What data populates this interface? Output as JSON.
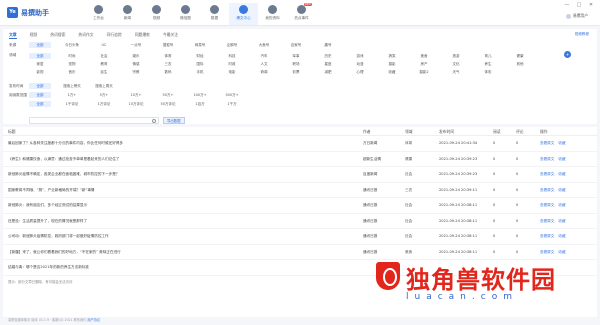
{
  "app": {
    "name": "易撰助手",
    "logo_glyph": "Ye",
    "brand_color": "#2f6fd6"
  },
  "nav": [
    {
      "label": "工作台",
      "icon": "home-icon"
    },
    {
      "label": "新闻",
      "icon": "news-icon"
    },
    {
      "label": "视频",
      "icon": "video-icon"
    },
    {
      "label": "微信图",
      "icon": "wechat-icon"
    },
    {
      "label": "数据",
      "icon": "data-icon"
    },
    {
      "label": "爆文中心",
      "icon": "hot-icon",
      "active": true
    },
    {
      "label": "我的资料",
      "icon": "folder-icon"
    },
    {
      "label": "热点事件",
      "icon": "fire-icon",
      "badge": "NEW"
    }
  ],
  "window": {
    "minimize": "—",
    "maximize": "□",
    "close": "✕",
    "user": "易撰用户"
  },
  "tabs": [
    {
      "label": "文章",
      "active": true
    },
    {
      "label": "视频"
    },
    {
      "label": "热词搜索"
    },
    {
      "label": "热词作文"
    },
    {
      "label": "同行追踪"
    },
    {
      "label": "同题爆款"
    },
    {
      "label": "今最关注"
    }
  ],
  "help_link": "视频教程",
  "filters": {
    "source": {
      "label": "来源",
      "options": [
        "全部",
        "今日头条",
        "UC",
        "一点号",
        "搜狐号",
        "网易号",
        "企鹅号",
        "大鱼号",
        "百家号",
        "趣号"
      ],
      "selected": 0
    },
    "category": {
      "label": "领域",
      "options": [
        "全部",
        "时尚",
        "社会",
        "娱乐",
        "体育",
        "财经",
        "科技",
        "汽车",
        "军事",
        "历史",
        "游戏",
        "搞笑",
        "美食",
        "旅游",
        "育儿",
        "健康",
        "家居",
        "宠物",
        "教育",
        "情感",
        "三农",
        "国际",
        "时政",
        "人文",
        "职场",
        "星座",
        "动漫",
        "摄影",
        "房产",
        "文化",
        "养生",
        "其他",
        "影视",
        "音乐",
        "民生",
        "宗教",
        "数码",
        "手机",
        "电影",
        "奇闻",
        "彩票",
        "减肥",
        "心理",
        "收藏",
        "摄影2",
        "天气",
        "体彩"
      ],
      "selected": 0
    },
    "time": {
      "label": "发布时间",
      "options": [
        "全部",
        "搜索上榜天",
        "搜索上周天"
      ],
      "selected": 0
    },
    "reads": {
      "label": "阅读数范围",
      "options": [
        "全部",
        "1万+",
        "5万+",
        "10万+",
        "50万+",
        "100万+",
        "500万+"
      ],
      "selected": 0
    },
    "comments": {
      "label": "",
      "options": [
        "全部",
        "1千评论",
        "1万评论",
        "10万评论",
        "50万评论",
        "1百万",
        "1千万"
      ],
      "selected": 0
    }
  },
  "search": {
    "placeholder": "",
    "button": "导出数据",
    "round_button": "+"
  },
  "table": {
    "headers": [
      "标题",
      "作者",
      "领域",
      "发布时间",
      "阅读",
      "评论",
      "操作"
    ],
    "rows": [
      {
        "title": "最后回家了？从各种关注度都十分沉的事件内容，你比任何时候还好得多",
        "author": "万日新闻",
        "cat": "体育",
        "time": "2021-09-24 20:41:34",
        "read": "0",
        "cmt": "0"
      },
      {
        "title": "《养生》和健康饮食，以满意：通过检查不单单是看起来的人们记住了",
        "author": "超新生活情",
        "cat": "健康",
        "time": "2021-09-24 20:39:23",
        "read": "0",
        "cmt": "0"
      },
      {
        "title": "新冠肺炎疫情不确定，各类企业都在面临困难，城市防控的下一步是？",
        "author": "百度新闻",
        "cat": "社会",
        "time": "2021-09-24 20:39:23",
        "read": "0",
        "cmt": "0"
      },
      {
        "title": "国家教育不同哦、“厕”、产业新格局的开端？“新”事情",
        "author": "通讯日报",
        "cat": "三农",
        "time": "2021-09-24 20:39:11",
        "read": "0",
        "cmt": "0"
      },
      {
        "title": "新冠肺炎：我有朋友们，多个经过测试的结果显示",
        "author": "通讯日报",
        "cat": "社会",
        "time": "2021-09-24 20:38:11",
        "read": "0",
        "cmt": "0"
      },
      {
        "title": "还是没：生活质量提升了，现在的情况就是那样了",
        "author": "通讯日报",
        "cat": "社会",
        "time": "2021-09-24 20:38:11",
        "read": "0",
        "cmt": "0"
      },
      {
        "title": "公司动：新冠肺炎疫情防控，政府部门将一起做好疫情防控工作",
        "author": "通讯日报",
        "cat": "社会",
        "time": "2021-09-24 20:38:11",
        "read": "0",
        "cmt": "0"
      },
      {
        "title": "【新疆】来了，就让你们看看我们的好地方，“不在家的” 美味正在进行",
        "author": "通讯日报",
        "cat": "美食",
        "time": "2021-09-24 20:38:11",
        "read": "0",
        "cmt": "0"
      },
      {
        "title": "结婚与离：哪个是否2021年的新的养生方法新标准",
        "author": "",
        "cat": "",
        "time": "",
        "read": "",
        "cmt": ""
      }
    ],
    "actions": [
      "查看原文",
      "收藏"
    ]
  },
  "hint": "提示：部分文章已删除，有可能会无法访问",
  "footer": {
    "text": "易撰自媒体助手 版本 V2.1.9 · 客服QQ 2021 联系我们",
    "link": "用户协议"
  },
  "watermark": {
    "text": "独角兽软件园",
    "url": "luacan.com"
  }
}
